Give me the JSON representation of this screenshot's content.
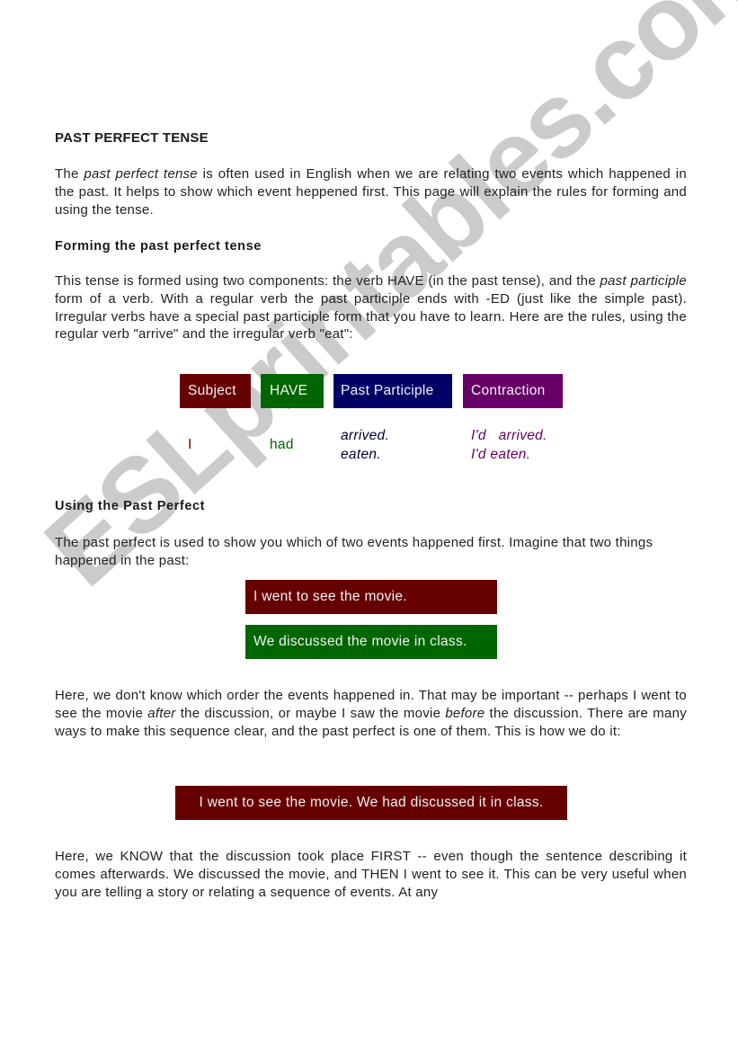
{
  "title": "PAST PERFECT TENSE",
  "intro": {
    "before": "The ",
    "italic": "past perfect tense",
    "after": " is often used in English when we are relating two events which happened in the past. It helps to show which event heppened first. This page will explain the rules for forming and using the tense."
  },
  "forming": {
    "heading": "Forming the past perfect tense",
    "p1": "This tense is formed using two components: the verb HAVE (in the past tense), and the ",
    "p_italic": "past participle",
    "p2": " form of a verb. With a regular verb the past participle ends with -ED (just like the simple past). Irregular verbs have a special past participle form that you have to learn. Here are the rules, using the regular verb \"arrive\" and the irregular verb \"eat\":",
    "table": {
      "headers": [
        {
          "label": "Subject",
          "color": "#660000"
        },
        {
          "label": "HAVE",
          "color": "#006600"
        },
        {
          "label": "Past Participle",
          "color": "#000066"
        },
        {
          "label": "Contraction",
          "color": "#660066"
        }
      ],
      "subject": "I",
      "have": "had",
      "participle": [
        "arrived.",
        "eaten."
      ],
      "contraction": [
        "I'd   arrived.",
        "I'd eaten."
      ]
    }
  },
  "using": {
    "heading": "Using the Past Perfect",
    "p1": "The past perfect is used to show you which of two events happened first. Imagine that two things happened in the past:",
    "event1": "I went to see the movie.",
    "event2": "We discussed the movie in class.",
    "p2_a": "Here, we don't know which order the events happened in. That may be important -- perhaps I went to see the movie ",
    "p2_after": "after",
    "p2_b": " the discussion, or maybe I saw the movie ",
    "p2_before": "before",
    "p2_c": " the discussion. There are many ways to make this sequence clear, and the past perfect is one of them. This is how we do it:",
    "combined": "I went to see the movie. We had discussed it in class.",
    "p3": "Here, we KNOW that the discussion took place FIRST -- even though the sentence describing it comes afterwards. We discussed the movie, and THEN I went to see it. This can be very useful when you are telling a story or relating a sequence of events. At any"
  },
  "watermark": "ESLprintables.com"
}
